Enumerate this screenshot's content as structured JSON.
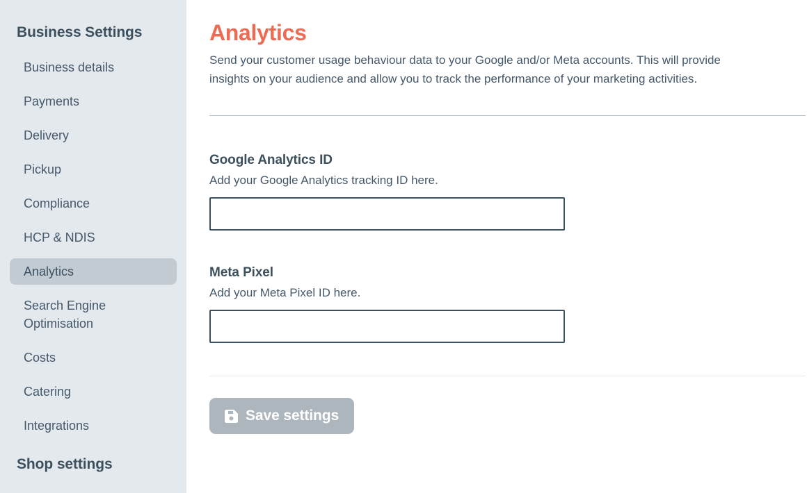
{
  "sidebar": {
    "business_section_title": "Business Settings",
    "items": [
      {
        "label": "Business details",
        "active": false
      },
      {
        "label": "Payments",
        "active": false
      },
      {
        "label": "Delivery",
        "active": false
      },
      {
        "label": "Pickup",
        "active": false
      },
      {
        "label": "Compliance",
        "active": false
      },
      {
        "label": "HCP & NDIS",
        "active": false
      },
      {
        "label": "Analytics",
        "active": true
      },
      {
        "label": "Search Engine Optimisation",
        "active": false
      },
      {
        "label": "Costs",
        "active": false
      },
      {
        "label": "Catering",
        "active": false
      },
      {
        "label": "Integrations",
        "active": false
      }
    ],
    "shop_section_title": "Shop settings"
  },
  "main": {
    "title": "Analytics",
    "description": "Send your customer usage behaviour data to your Google and/or Meta accounts. This will provide insights on your audience and allow you to track the performance of your marketing activities.",
    "fields": [
      {
        "label": "Google Analytics ID",
        "help": "Add your Google Analytics tracking ID here.",
        "value": "",
        "placeholder": ""
      },
      {
        "label": "Meta Pixel",
        "help": "Add your Meta Pixel ID here.",
        "value": "",
        "placeholder": ""
      }
    ],
    "save_button": {
      "label": "Save settings",
      "icon": "save-floppy-disk-icon"
    }
  },
  "colors": {
    "accent_title": "#ec6b52",
    "sidebar_bg": "#e4e9ee",
    "sidebar_active_bg": "#c3cbd2",
    "text_primary": "#3c4f5c",
    "text_secondary": "#45586a",
    "input_border": "#3c4f5c",
    "save_button_bg": "#aeb6bd",
    "divider": "#b4bfc8",
    "divider_light": "#e7e9eb"
  }
}
